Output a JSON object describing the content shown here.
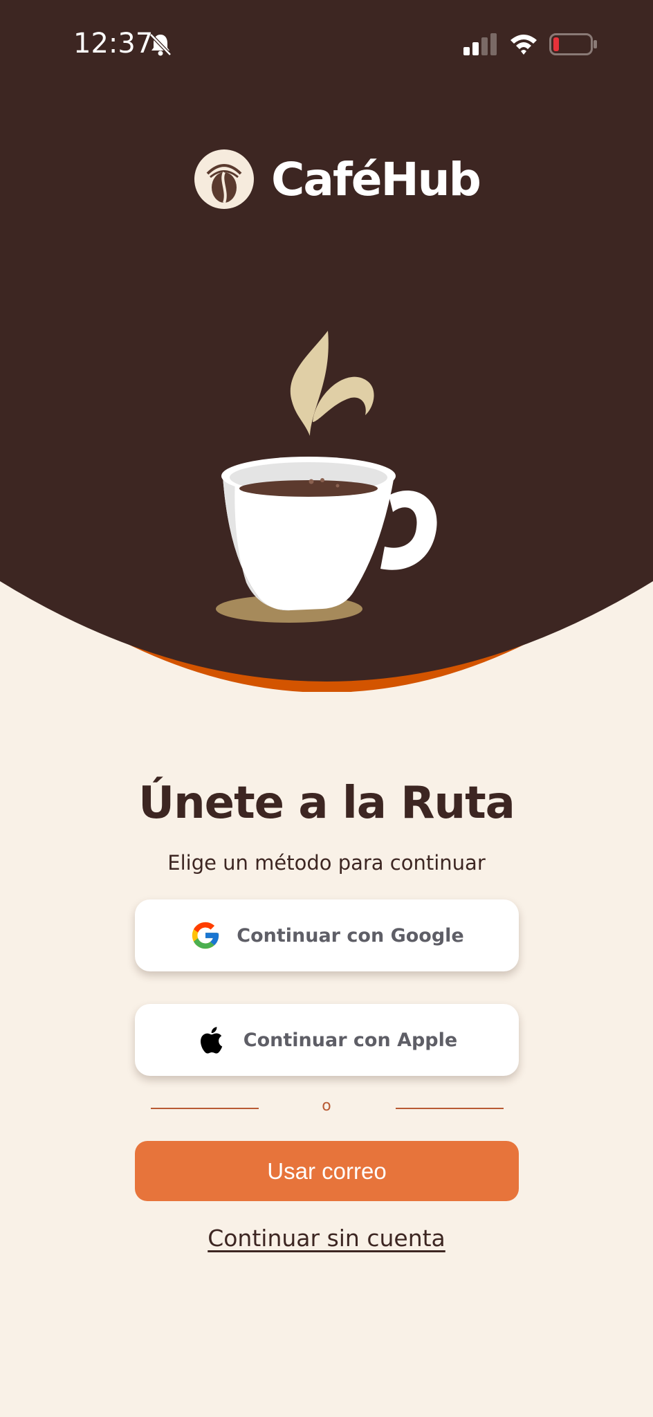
{
  "status_bar": {
    "time": "12:37",
    "icons": [
      "bell-muted-icon",
      "cellular-signal-icon",
      "wifi-icon",
      "battery-low-icon"
    ]
  },
  "brand": {
    "name": "CaféHub",
    "logo_icon": "coffee-bean-logo-icon"
  },
  "hero": {
    "illustration": "coffee-cup-illustration",
    "colors": {
      "background": "#3d2622",
      "accent_band": "#d35400",
      "steam": "#e0cfa6",
      "saucer_shadow": "#a68a5b"
    }
  },
  "main": {
    "title": "Únete a la Ruta",
    "subtitle": "Elige un método para continuar",
    "google_button": {
      "label": "Continuar con Google",
      "icon": "google-icon"
    },
    "apple_button": {
      "label": "Continuar con Apple",
      "icon": "apple-icon"
    },
    "divider_text": "o",
    "email_button": {
      "label": "Usar correo"
    },
    "guest_link": {
      "label": "Continuar sin cuenta"
    }
  },
  "colors": {
    "page_background": "#f9f1e7",
    "primary_button": "#e7743b",
    "text_dark": "#3d2622",
    "divider": "#b85a33"
  }
}
